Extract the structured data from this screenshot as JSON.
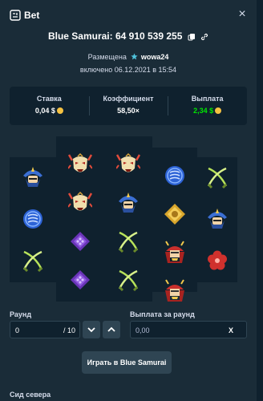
{
  "header": {
    "title": "Bet",
    "close": "×"
  },
  "bet": {
    "game_line": "Blue Samurai: 64 910 539 255",
    "placed_label": "Размещена",
    "user": "wowa24",
    "date_line": "включено 06.12.2021 в 15:54"
  },
  "stats": {
    "stake_label": "Ставка",
    "stake_value": "0,04 $",
    "coef_label": "Коэффициент",
    "coef_value": "58,50×",
    "payout_label": "Выплата",
    "payout_value": "2,34 $"
  },
  "reels": [
    [
      "samurai-blue",
      "coin-blue",
      "swords"
    ],
    [
      "demon-mask",
      "demon-mask",
      "gem-purple",
      "gem-purple"
    ],
    [
      "demon-mask",
      "samurai-blue",
      "swords",
      "swords"
    ],
    [
      "coin-blue",
      "shuriken-gold",
      "helmet-red",
      "helmet-red"
    ],
    [
      "swords",
      "samurai-blue",
      "flower-red"
    ]
  ],
  "controls": {
    "round_label": "Раунд",
    "round_value": "0",
    "round_total": "/ 10",
    "payout_round_label": "Выплата за раунд",
    "payout_round_value": "0,00",
    "clear": "X",
    "play_label": "Играть в Blue Samurai",
    "seed_label": "Сид севера"
  },
  "colors": {
    "bg": "#1a2c38",
    "panel": "#0f212e",
    "green": "#00e701",
    "border": "#2f4553"
  }
}
